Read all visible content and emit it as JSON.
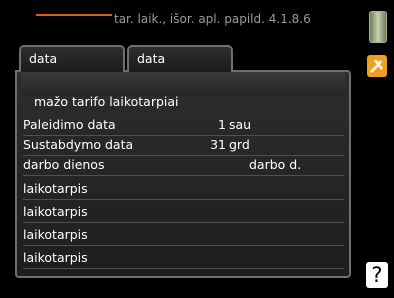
{
  "header": {
    "title": "tar. laik., išor. apl. papild.  4.1.8.6"
  },
  "tabs": [
    {
      "label": "data"
    },
    {
      "label": "data"
    }
  ],
  "section": {
    "title": "mažo tarifo laikotarpiai"
  },
  "rows": [
    {
      "label": "Paleidimo data",
      "value": "1",
      "unit": "sau"
    },
    {
      "label": "Sustabdymo data",
      "value": "31",
      "unit": "grd"
    },
    {
      "label": "darbo dienos",
      "value": "",
      "unit": "darbo d."
    },
    {
      "label": "laikotarpis",
      "value": "",
      "unit": ""
    },
    {
      "label": "laikotarpis",
      "value": "",
      "unit": ""
    },
    {
      "label": "laikotarpis",
      "value": "",
      "unit": ""
    },
    {
      "label": "laikotarpis",
      "value": "",
      "unit": ""
    }
  ],
  "sidebar": {
    "help_label": "?"
  },
  "colors": {
    "accent": "#e05a20",
    "background": "#000000",
    "panel": "#262626"
  },
  "icons": [
    "thermometer-icon",
    "tools-icon",
    "help-icon"
  ]
}
